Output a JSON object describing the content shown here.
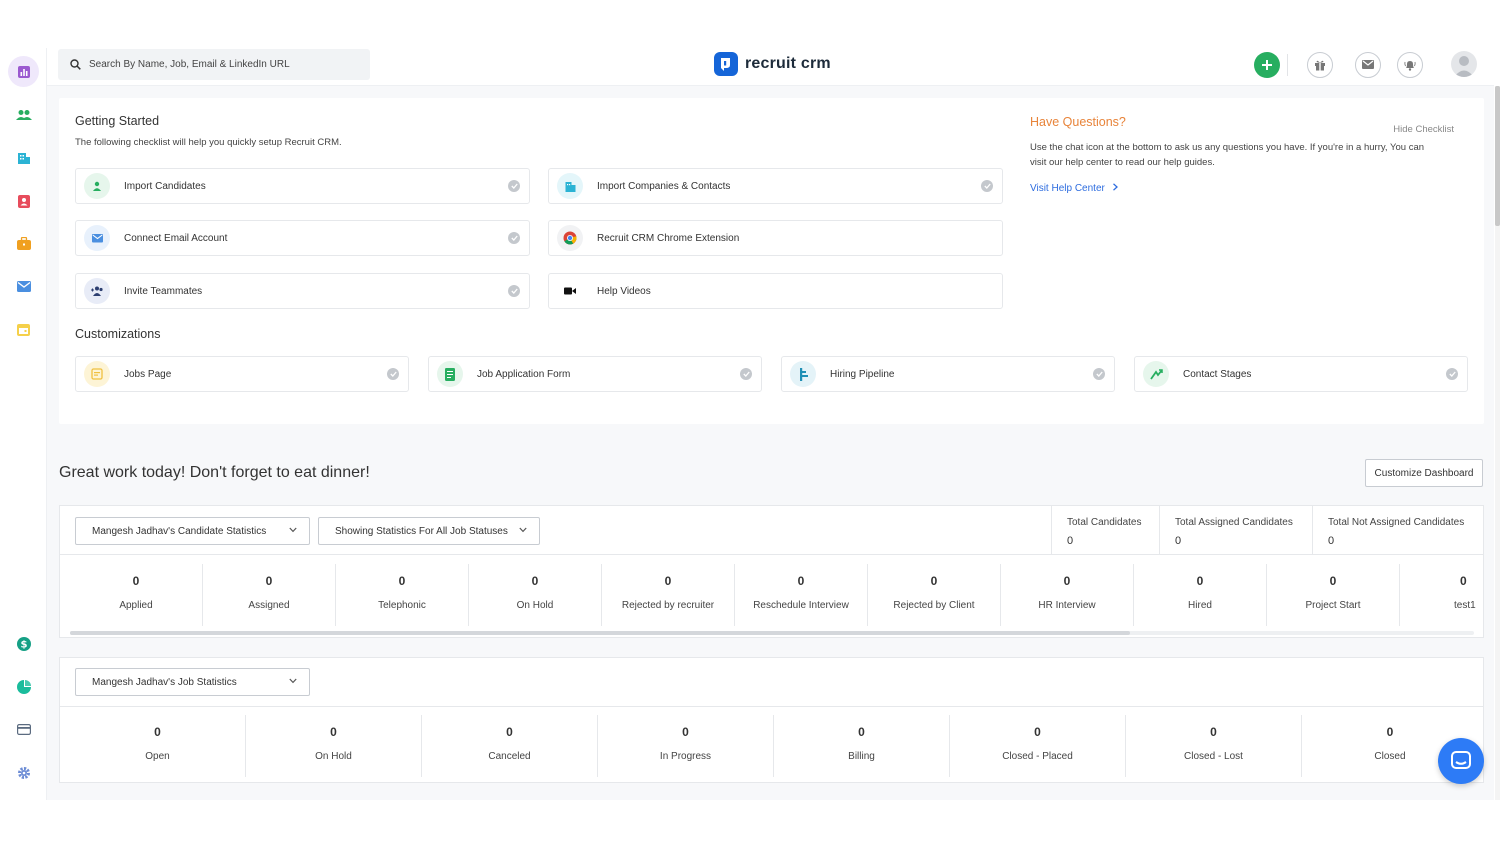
{
  "search": {
    "placeholder": "Search By Name, Job, Email & LinkedIn URL"
  },
  "brand": {
    "name": "recruit crm",
    "color": "#1565d8"
  },
  "topbar": {
    "icons": [
      "add-icon",
      "gift-icon",
      "mail-icon",
      "notification-icon",
      "avatar"
    ]
  },
  "sidebar": {
    "items": [
      {
        "icon": "dashboard-icon",
        "active": true
      },
      {
        "icon": "candidates-icon"
      },
      {
        "icon": "companies-icon"
      },
      {
        "icon": "contacts-icon"
      },
      {
        "icon": "jobs-icon"
      },
      {
        "icon": "email-icon"
      },
      {
        "icon": "calendar-icon"
      },
      {
        "icon": "billing-icon"
      },
      {
        "icon": "reports-icon"
      },
      {
        "icon": "card-icon"
      },
      {
        "icon": "settings-icon"
      }
    ]
  },
  "getting_started": {
    "title": "Getting Started",
    "subtitle": "The following checklist will help you quickly setup Recruit CRM.",
    "hide_label": "Hide Checklist",
    "items": [
      {
        "label": "Import Candidates",
        "icon": "person-icon"
      },
      {
        "label": "Import Companies & Contacts",
        "icon": "building-icon"
      },
      {
        "label": "Connect Email Account",
        "icon": "mail-icon"
      },
      {
        "label": "Recruit CRM Chrome Extension",
        "icon": "chrome-icon"
      },
      {
        "label": "Invite Teammates",
        "icon": "team-icon"
      },
      {
        "label": "Help Videos",
        "icon": "video-icon"
      }
    ]
  },
  "customizations": {
    "title": "Customizations",
    "items": [
      {
        "label": "Jobs Page",
        "icon": "jobs-page-icon"
      },
      {
        "label": "Job Application Form",
        "icon": "form-icon"
      },
      {
        "label": "Hiring Pipeline",
        "icon": "pipeline-icon"
      },
      {
        "label": "Contact Stages",
        "icon": "stages-icon"
      }
    ]
  },
  "help": {
    "title": "Have Questions?",
    "text": "Use the chat icon at the bottom to ask us any questions you have. If you're in a hurry, You can visit our help center to read our help guides.",
    "link": "Visit Help Center"
  },
  "dashboard": {
    "greeting": "Great work today! Don't forget to eat dinner!",
    "customize_label": "Customize Dashboard"
  },
  "candidate_stats": {
    "dropdown": "Mangesh Jadhav's Candidate Statistics",
    "status_filter": "Showing Statistics For All Job Statuses",
    "totals": [
      {
        "label": "Total Candidates",
        "value": "0"
      },
      {
        "label": "Total Assigned Candidates",
        "value": "0"
      },
      {
        "label": "Total Not Assigned Candidates",
        "value": "0"
      }
    ],
    "stages": [
      {
        "label": "Applied",
        "value": "0"
      },
      {
        "label": "Assigned",
        "value": "0"
      },
      {
        "label": "Telephonic",
        "value": "0"
      },
      {
        "label": "On Hold",
        "value": "0"
      },
      {
        "label": "Rejected by recruiter",
        "value": "0"
      },
      {
        "label": "Reschedule Interview",
        "value": "0"
      },
      {
        "label": "Rejected by Client",
        "value": "0"
      },
      {
        "label": "HR Interview",
        "value": "0"
      },
      {
        "label": "Hired",
        "value": "0"
      },
      {
        "label": "Project Start",
        "value": "0"
      },
      {
        "label": "test1",
        "value": "0"
      }
    ]
  },
  "job_stats": {
    "dropdown": "Mangesh Jadhav's Job Statistics",
    "stages": [
      {
        "label": "Open",
        "value": "0"
      },
      {
        "label": "On Hold",
        "value": "0"
      },
      {
        "label": "Canceled",
        "value": "0"
      },
      {
        "label": "In Progress",
        "value": "0"
      },
      {
        "label": "Billing",
        "value": "0"
      },
      {
        "label": "Closed - Placed",
        "value": "0"
      },
      {
        "label": "Closed - Lost",
        "value": "0"
      },
      {
        "label": "Closed",
        "value": "0"
      }
    ]
  },
  "colors": {
    "accent_orange": "#e8843a",
    "link_blue": "#2d6cdf",
    "add_green": "#27ae60",
    "chat_blue": "#2d7bf6"
  }
}
